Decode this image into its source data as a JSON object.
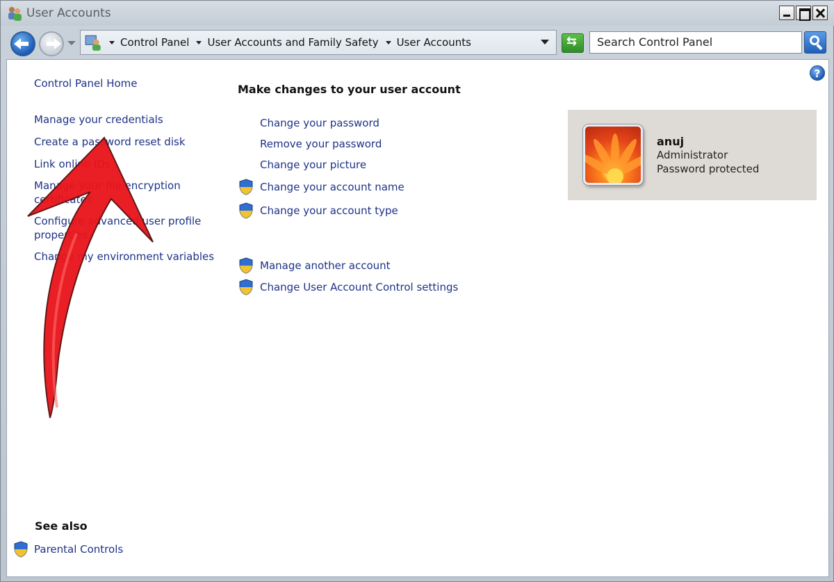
{
  "window": {
    "title": "User Accounts"
  },
  "address_bar": {
    "crumbs": [
      "Control Panel",
      "User Accounts and Family Safety",
      "User Accounts"
    ]
  },
  "search": {
    "placeholder": "Search Control Panel"
  },
  "left_nav": {
    "home": "Control Panel Home",
    "items": [
      "Manage your credentials",
      "Create a password reset disk",
      "Link online IDs",
      "Manage your file encryption certificates",
      "Configure advanced user profile properties",
      "Change my environment variables"
    ]
  },
  "main": {
    "title": "Make changes to your user account",
    "tasks": [
      "Change your password",
      "Remove your password",
      "Change your picture",
      "Change your account name",
      "Change your account type"
    ],
    "other_tasks": [
      "Manage another account",
      "Change User Account Control settings"
    ]
  },
  "user": {
    "name": "anuj",
    "role": "Administrator",
    "status": "Password protected"
  },
  "see_also": {
    "title": "See also",
    "items": [
      "Parental Controls"
    ]
  },
  "colors": {
    "link": "#1e3287",
    "annotation": "#e8141a"
  }
}
